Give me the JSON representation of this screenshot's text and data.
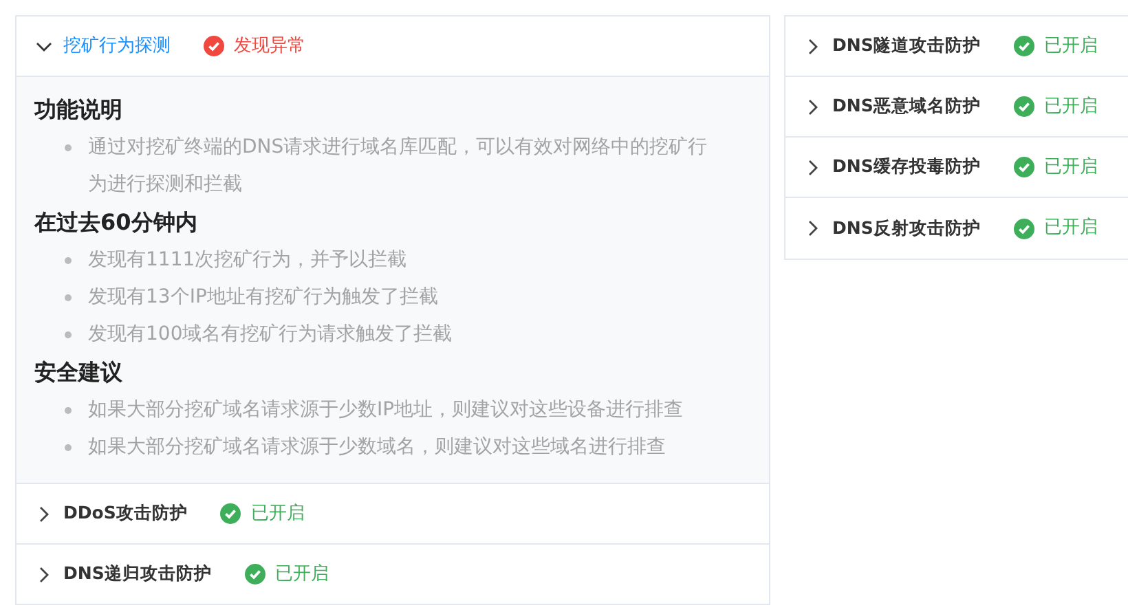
{
  "columns": [
    {
      "panels": [
        {
          "title": "挖矿行为探测",
          "expanded": true,
          "status": {
            "kind": "alert",
            "label": "发现异常"
          },
          "sections": [
            {
              "heading": "功能说明",
              "items": [
                "通过对挖矿终端的DNS请求进行域名库匹配，可以有效对网络中的挖矿行为进行探测和拦截"
              ]
            },
            {
              "heading": "在过去60分钟内",
              "items": [
                "发现有1111次挖矿行为，并予以拦截",
                "发现有13个IP地址有挖矿行为触发了拦截",
                "发现有100域名有挖矿行为请求触发了拦截"
              ]
            },
            {
              "heading": "安全建议",
              "items": [
                "如果大部分挖矿域名请求源于少数IP地址，则建议对这些设备进行排查",
                "如果大部分挖矿域名请求源于少数域名，则建议对这些域名进行排查"
              ]
            }
          ]
        },
        {
          "title": "DDoS攻击防护",
          "expanded": false,
          "status": {
            "kind": "ok",
            "label": "已开启"
          }
        },
        {
          "title": "DNS递归攻击防护",
          "expanded": false,
          "status": {
            "kind": "ok",
            "label": "已开启"
          }
        }
      ]
    },
    {
      "panels": [
        {
          "title": "DNS隧道攻击防护",
          "expanded": false,
          "status": {
            "kind": "ok",
            "label": "已开启"
          }
        },
        {
          "title": "DNS恶意域名防护",
          "expanded": false,
          "status": {
            "kind": "ok",
            "label": "已开启"
          }
        },
        {
          "title": "DNS缓存投毒防护",
          "expanded": false,
          "status": {
            "kind": "ok",
            "label": "已开启"
          }
        },
        {
          "title": "DNS反射攻击防护",
          "expanded": false,
          "status": {
            "kind": "ok",
            "label": "已开启"
          }
        }
      ]
    }
  ]
}
